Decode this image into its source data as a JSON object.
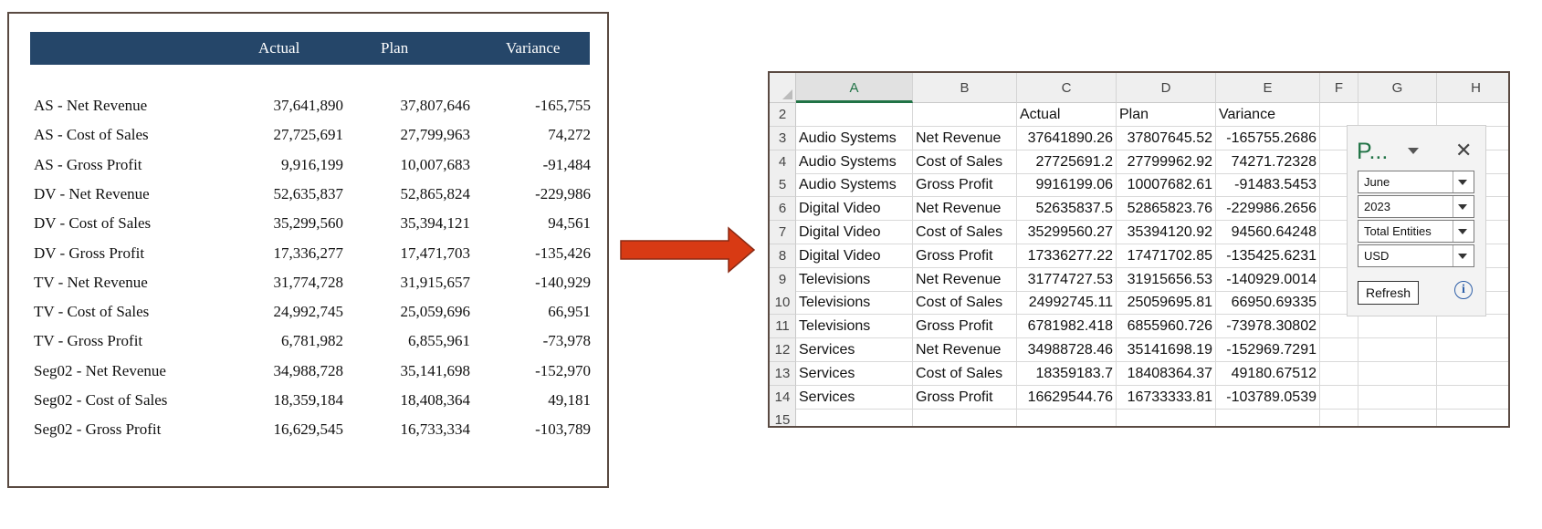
{
  "report": {
    "headers": {
      "actual": "Actual",
      "plan": "Plan",
      "variance": "Variance"
    },
    "rows": [
      {
        "label": "AS - Net Revenue",
        "actual": "37,641,890",
        "plan": "37,807,646",
        "variance": "-165,755"
      },
      {
        "label": "AS - Cost of Sales",
        "actual": "27,725,691",
        "plan": "27,799,963",
        "variance": "74,272"
      },
      {
        "label": "AS - Gross Profit",
        "actual": "9,916,199",
        "plan": "10,007,683",
        "variance": "-91,484"
      },
      {
        "label": "DV - Net Revenue",
        "actual": "52,635,837",
        "plan": "52,865,824",
        "variance": "-229,986"
      },
      {
        "label": "DV - Cost of Sales",
        "actual": "35,299,560",
        "plan": "35,394,121",
        "variance": "94,561"
      },
      {
        "label": "DV - Gross Profit",
        "actual": "17,336,277",
        "plan": "17,471,703",
        "variance": "-135,426"
      },
      {
        "label": "TV - Net Revenue",
        "actual": "31,774,728",
        "plan": "31,915,657",
        "variance": "-140,929"
      },
      {
        "label": "TV - Cost of Sales",
        "actual": "24,992,745",
        "plan": "25,059,696",
        "variance": "66,951"
      },
      {
        "label": "TV - Gross Profit",
        "actual": "6,781,982",
        "plan": "6,855,961",
        "variance": "-73,978"
      },
      {
        "label": "Seg02 - Net Revenue",
        "actual": "34,988,728",
        "plan": "35,141,698",
        "variance": "-152,970"
      },
      {
        "label": "Seg02 - Cost of Sales",
        "actual": "18,359,184",
        "plan": "18,408,364",
        "variance": "49,181"
      },
      {
        "label": "Seg02 - Gross Profit",
        "actual": "16,629,545",
        "plan": "16,733,334",
        "variance": "-103,789"
      }
    ]
  },
  "excel": {
    "columns": [
      "A",
      "B",
      "C",
      "D",
      "E",
      "F",
      "G",
      "H"
    ],
    "rows": [
      {
        "num": "2",
        "cells": [
          "",
          "",
          "Actual",
          "Plan",
          "Variance",
          "",
          "",
          ""
        ]
      },
      {
        "num": "3",
        "cells": [
          "Audio Systems",
          "Net Revenue",
          "37641890.26",
          "37807645.52",
          "-165755.2686",
          "",
          "",
          ""
        ]
      },
      {
        "num": "4",
        "cells": [
          "Audio Systems",
          "Cost of Sales",
          "27725691.2",
          "27799962.92",
          "74271.72328",
          "",
          "",
          ""
        ]
      },
      {
        "num": "5",
        "cells": [
          "Audio Systems",
          "Gross Profit",
          "9916199.06",
          "10007682.61",
          "-91483.5453",
          "",
          "",
          ""
        ]
      },
      {
        "num": "6",
        "cells": [
          "Digital Video",
          "Net Revenue",
          "52635837.5",
          "52865823.76",
          "-229986.2656",
          "",
          "",
          ""
        ]
      },
      {
        "num": "7",
        "cells": [
          "Digital Video",
          "Cost of Sales",
          "35299560.27",
          "35394120.92",
          "94560.64248",
          "",
          "",
          ""
        ]
      },
      {
        "num": "8",
        "cells": [
          "Digital Video",
          "Gross Profit",
          "17336277.22",
          "17471702.85",
          "-135425.6231",
          "",
          "",
          ""
        ]
      },
      {
        "num": "9",
        "cells": [
          "Televisions",
          "Net Revenue",
          "31774727.53",
          "31915656.53",
          "-140929.0014",
          "",
          "",
          ""
        ]
      },
      {
        "num": "10",
        "cells": [
          "Televisions",
          "Cost of Sales",
          "24992745.11",
          "25059695.81",
          "66950.69335",
          "",
          "",
          ""
        ]
      },
      {
        "num": "11",
        "cells": [
          "Televisions",
          "Gross Profit",
          "6781982.418",
          "6855960.726",
          "-73978.30802",
          "",
          "",
          ""
        ]
      },
      {
        "num": "12",
        "cells": [
          "Services",
          "Net Revenue",
          "34988728.46",
          "35141698.19",
          "-152969.7291",
          "",
          "",
          ""
        ]
      },
      {
        "num": "13",
        "cells": [
          "Services",
          "Cost of Sales",
          "18359183.7",
          "18408364.37",
          "49180.67512",
          "",
          "",
          ""
        ]
      },
      {
        "num": "14",
        "cells": [
          "Services",
          "Gross Profit",
          "16629544.76",
          "16733333.81",
          "-103789.0539",
          "",
          "",
          ""
        ]
      },
      {
        "num": "15",
        "cells": [
          "",
          "",
          "",
          "",
          "",
          "",
          "",
          ""
        ]
      }
    ]
  },
  "pane": {
    "title": "P...",
    "month": "June",
    "year": "2023",
    "entity": "Total Entities",
    "currency": "USD",
    "refresh_label": "Refresh",
    "info_glyph": "i"
  },
  "colors": {
    "report_header_bg": "#254669",
    "arrow_fill": "#d83a14",
    "excel_green": "#217346"
  }
}
